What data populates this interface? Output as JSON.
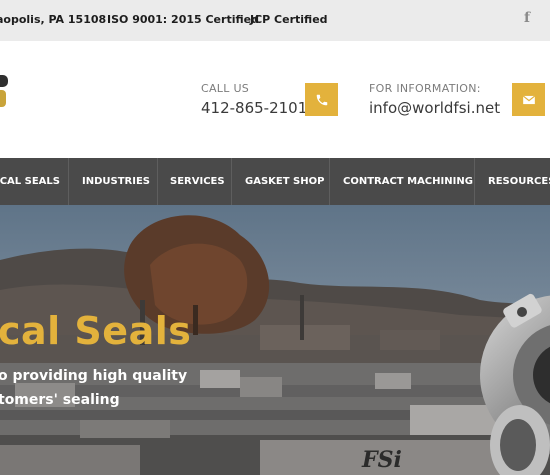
{
  "topbar": {
    "address": "aopolis, PA 15108",
    "iso": "ISO 9001: 2015 Certified",
    "jcp": "JCP  Certified",
    "social": "f"
  },
  "header": {
    "call_label": "CALL US",
    "call_value": "412-865-2101",
    "info_label": "FOR INFORMATION:",
    "info_value": "info@worldfsi.net"
  },
  "nav": {
    "items": [
      "ICAL SEALS",
      "INDUSTRIES",
      "SERVICES",
      "GASKET SHOP",
      "CONTRACT MACHINING",
      "RESOURCES"
    ]
  },
  "hero": {
    "title": "cal Seals",
    "line1": "o providing high quality",
    "line2": "tomers' sealing",
    "mark": "FSi"
  },
  "colors": {
    "accent": "#e3b23c",
    "nav_bg": "#4a4a4a",
    "topbar_bg": "#ebebeb"
  },
  "icons": [
    "facebook-icon",
    "phone-icon",
    "envelope-icon"
  ]
}
